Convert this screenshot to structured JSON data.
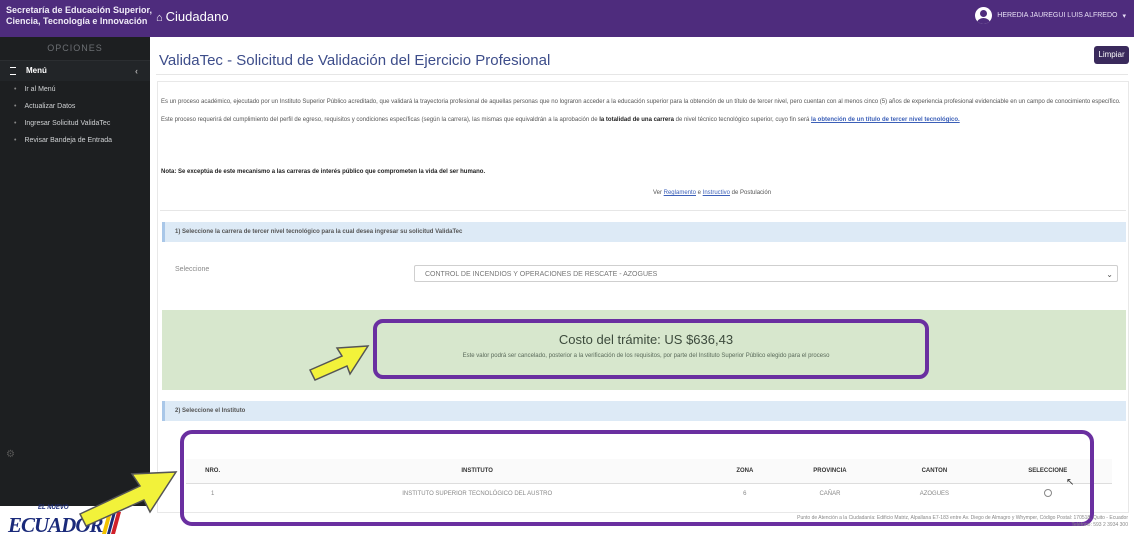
{
  "topbar": {
    "brand_line1": "Secretaría de Educación Superior,",
    "brand_line2": "Ciencia, Tecnología e Innovación",
    "home_label": "Ciudadano",
    "user_name": "HEREDIA JAUREGUI LUIS ALFREDO"
  },
  "sidebar": {
    "opciones": "OPCIONES",
    "menu_label": "Menú",
    "items": [
      {
        "label": "Ir al Menú"
      },
      {
        "label": "Actualizar Datos"
      },
      {
        "label": "Ingresar Solicitud ValidaTec"
      },
      {
        "label": "Revisar Bandeja de Entrada"
      }
    ]
  },
  "logo": {
    "top": "EL NUEVO",
    "main": "ECUADOR"
  },
  "page": {
    "title": "ValidaTec - Solicitud de Validación del Ejercicio Profesional",
    "clear_label": "Limpiar"
  },
  "intro": {
    "p1": "Es un proceso académico, ejecutado por un Instituto Superior Público acreditado, que validará la trayectoria profesional de aquellas personas que no lograron acceder a la educación superior para la obtención de un título de tercer nivel, pero cuentan con al menos cinco (5) años de experiencia profesional evidenciable en un campo de conocimiento específico.",
    "p2_a": "Este proceso requerirá del cumplimiento del perfil de egreso, requisitos y condiciones específicas (según la carrera), las mismas que equivaldrán a la aprobación de ",
    "p2_b": "la totalidad de una carrera",
    "p2_c": " de nivel técnico tecnológico superior, cuyo fin será ",
    "p2_d": "la obtención de un título de tercer nivel tecnológico.",
    "nota": "Nota: Se exceptúa de este mecanismo a las carreras de interés público que comprometen la vida del ser humano.",
    "ver_a": "Ver ",
    "ver_link1": "Reglamento",
    "ver_b": " e ",
    "ver_link2": "Instructivo",
    "ver_c": " de Postulación"
  },
  "section1": {
    "header": "1) Seleccione la carrera de tercer nivel tecnológico para la cual desea ingresar su solicitud ValidaTec",
    "select_label": "Seleccione",
    "selected_value": "CONTROL DE INCENDIOS Y OPERACIONES DE RESCATE - AZOGUES"
  },
  "cost": {
    "title": "Costo del trámite: US $636,43",
    "note": "Este valor podrá ser cancelado, posterior a la verificación de los requisitos, por parte del Instituto Superior Público elegido para el proceso"
  },
  "section2": {
    "header": "2) Seleccione el Instituto",
    "columns": [
      "NRO.",
      "INSTITUTO",
      "ZONA",
      "PROVINCIA",
      "CANTON",
      "SELECCIONE"
    ],
    "rows": [
      {
        "nro": "1",
        "instituto": "INSTITUTO SUPERIOR TECNOLÓGICO DEL AUSTRO",
        "zona": "6",
        "provincia": "CAÑAR",
        "canton": "AZOGUES"
      }
    ]
  },
  "footer": {
    "line1": "Punto de Atención a la Ciudadanía: Edificio Matriz, Alpallana E7-183 entre Av. Diego de Almagro y Whymper, Código Postal: 170518, Quito - Ecuador",
    "line2": "Teléfono: 593 2 3934 300"
  },
  "colors": {
    "topbar": "#4e2c7d",
    "sidebar": "#1d1f21",
    "highlight": "#6a2fa0",
    "arrow": "#f2f23a",
    "cost_bg": "#d7e7cd",
    "section_bg": "#ddeaf6"
  }
}
